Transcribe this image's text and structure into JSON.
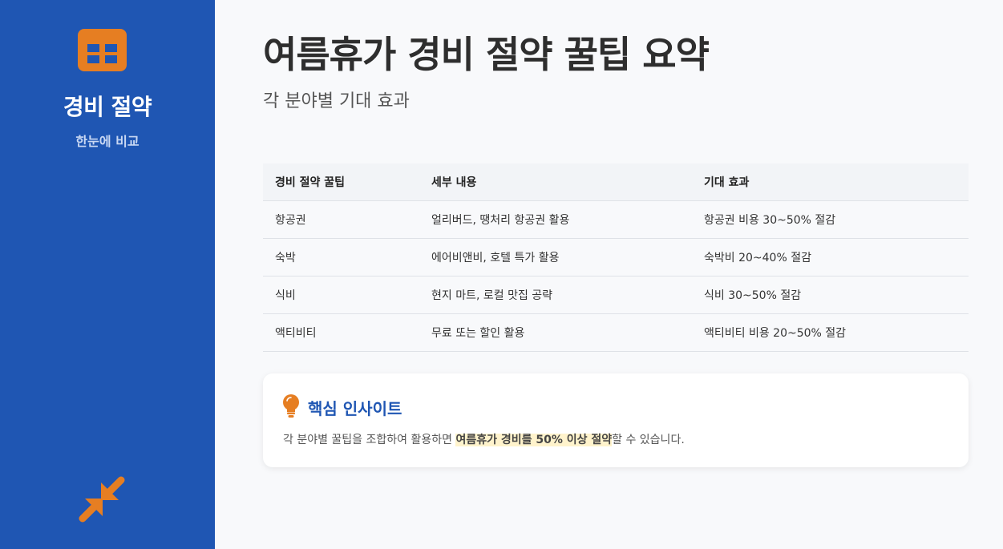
{
  "sidebar": {
    "logo_icon": "table-icon",
    "brand": "경비 절약",
    "subtitle": "한눈에 비교",
    "bottom_icon": "compress-arrows-icon"
  },
  "header": {
    "title": "여름휴가 경비 절약 꿀팁 요약",
    "subtitle": "각 분야별 기대 효과"
  },
  "table": {
    "columns": [
      "경비 절약 꿀팁",
      "세부 내용",
      "기대 효과"
    ],
    "rows": [
      [
        "항공권",
        "얼리버드, 땡처리 항공권 활용",
        "항공권 비용 30~50% 절감"
      ],
      [
        "숙박",
        "에어비앤비, 호텔 특가 활용",
        "숙박비 20~40% 절감"
      ],
      [
        "식비",
        "현지 마트, 로컬 맛집 공략",
        "식비 30~50% 절감"
      ],
      [
        "액티비티",
        "무료 또는 할인 활용",
        "액티비티 비용 20~50% 절감"
      ]
    ]
  },
  "insight": {
    "icon": "lightbulb-icon",
    "title": "핵심 인사이트",
    "text_before": "각 분야별 꿀팁을 조합하여 활용하면 ",
    "text_highlight": "여름휴가 경비를 50% 이상 절약",
    "text_after": "할 수 있습니다."
  },
  "colors": {
    "sidebar": "#1f56b3",
    "accent": "#e67e22",
    "highlight": "#fff3cc"
  }
}
